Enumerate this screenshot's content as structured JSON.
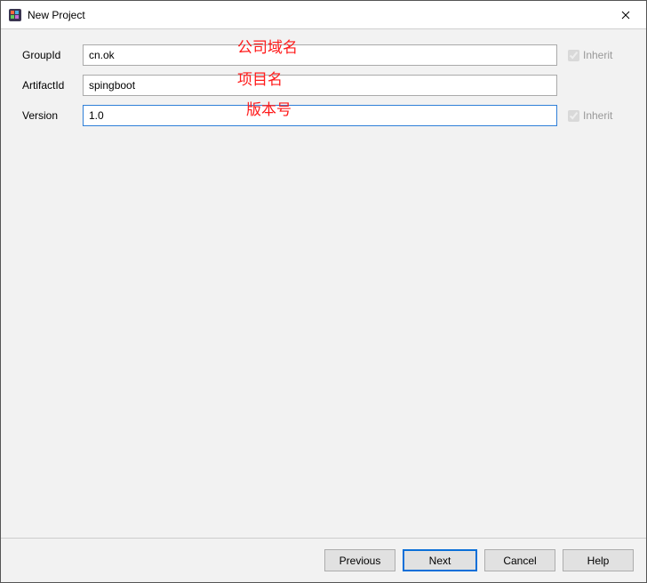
{
  "window": {
    "title": "New Project"
  },
  "form": {
    "groupId": {
      "label": "GroupId",
      "value": "cn.ok"
    },
    "artifactId": {
      "label": "ArtifactId",
      "value": "spingboot"
    },
    "version": {
      "label": "Version",
      "value": "1.0"
    }
  },
  "inherit": {
    "label": "Inherit",
    "groupIdChecked": true,
    "versionChecked": true
  },
  "annotations": {
    "groupId": "公司域名",
    "artifactId": "项目名",
    "version": "版本号"
  },
  "buttons": {
    "previous": "Previous",
    "next": "Next",
    "cancel": "Cancel",
    "help": "Help"
  }
}
